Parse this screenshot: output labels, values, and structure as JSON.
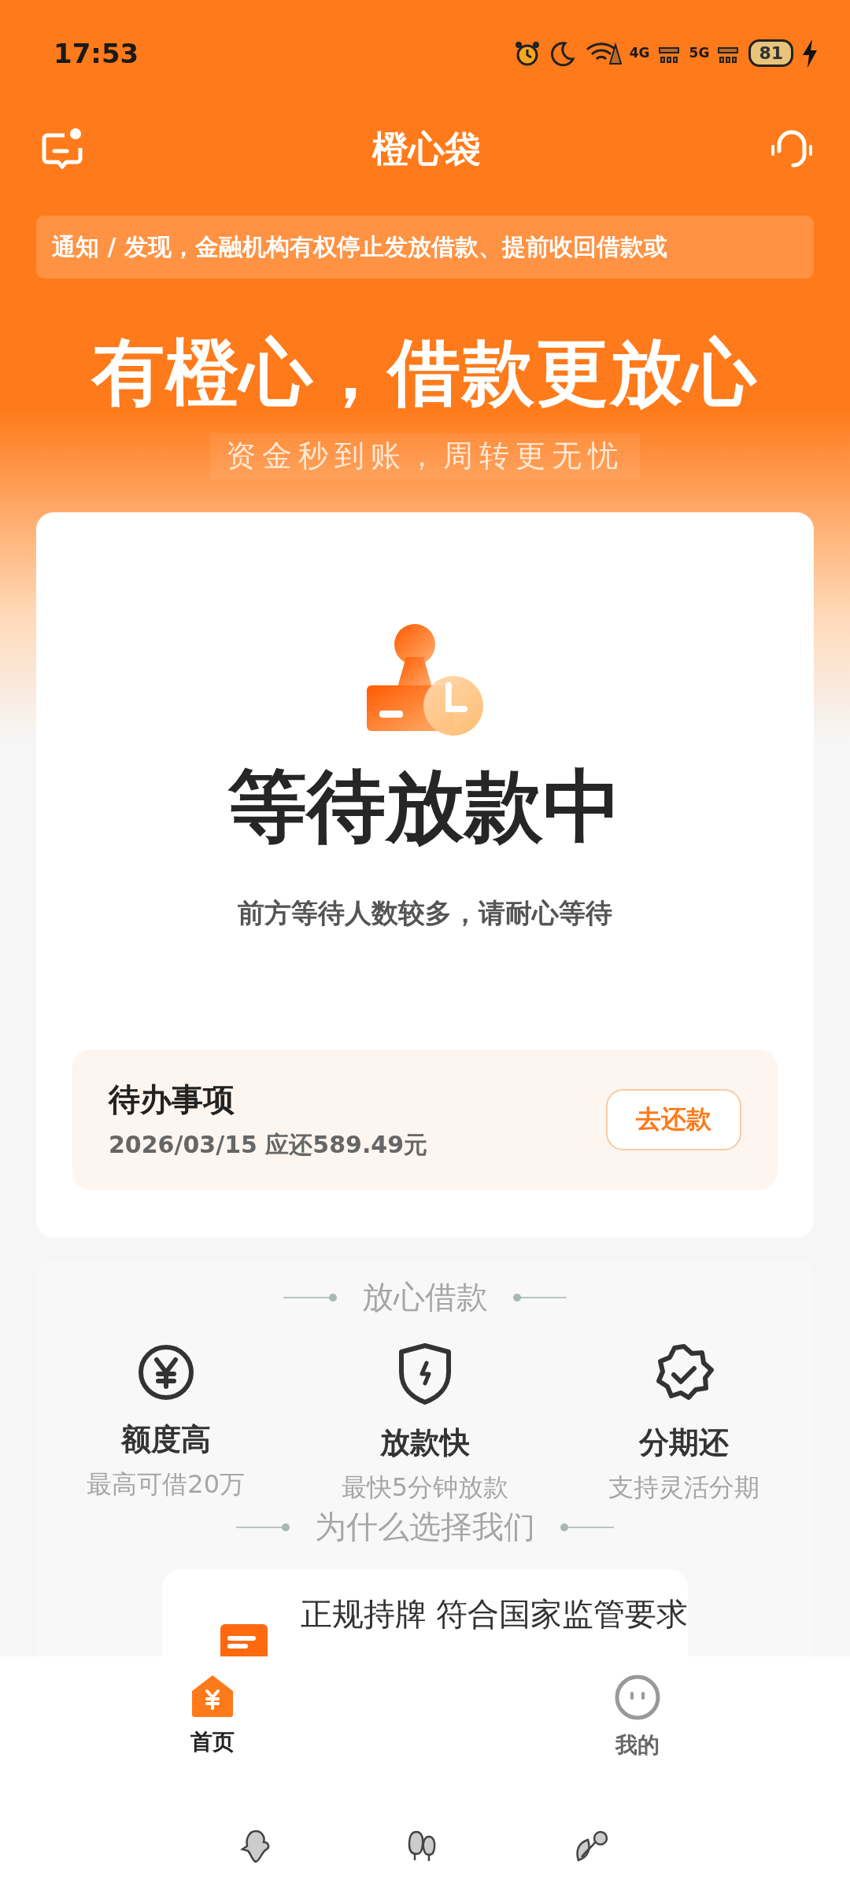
{
  "status_bar": {
    "time": "17:53",
    "network_1": "4G",
    "network_2": "5G",
    "battery": "81"
  },
  "header": {
    "title": "橙心袋"
  },
  "notice": {
    "text": "通知 / 发现，金融机构有权停止发放借款、提前收回借款或"
  },
  "banner": {
    "headline": "有橙心，借款更放心",
    "subtitle": "资金秒到账，周转更无忧"
  },
  "status_card": {
    "title": "等待放款中",
    "message": "前方等待人数较多，请耐心等待",
    "todo": {
      "title": "待办事项",
      "detail": "2026/03/15 应还589.49元",
      "button": "去还款"
    }
  },
  "features": {
    "heading": "放心借款",
    "items": [
      {
        "kind": "yen",
        "title": "额度高",
        "subtitle": "最高可借20万"
      },
      {
        "kind": "shield",
        "title": "放款快",
        "subtitle": "最快5分钟放款"
      },
      {
        "kind": "badge",
        "title": "分期还",
        "subtitle": "支持灵活分期"
      }
    ],
    "footer_heading": "为什么选择我们"
  },
  "license": {
    "title": "正规持牌 符合国家监管要求"
  },
  "tab_bar": {
    "items": [
      {
        "kind": "home",
        "label": "首页",
        "selected": true
      },
      {
        "kind": "me",
        "label": "我的",
        "selected": false
      }
    ]
  }
}
